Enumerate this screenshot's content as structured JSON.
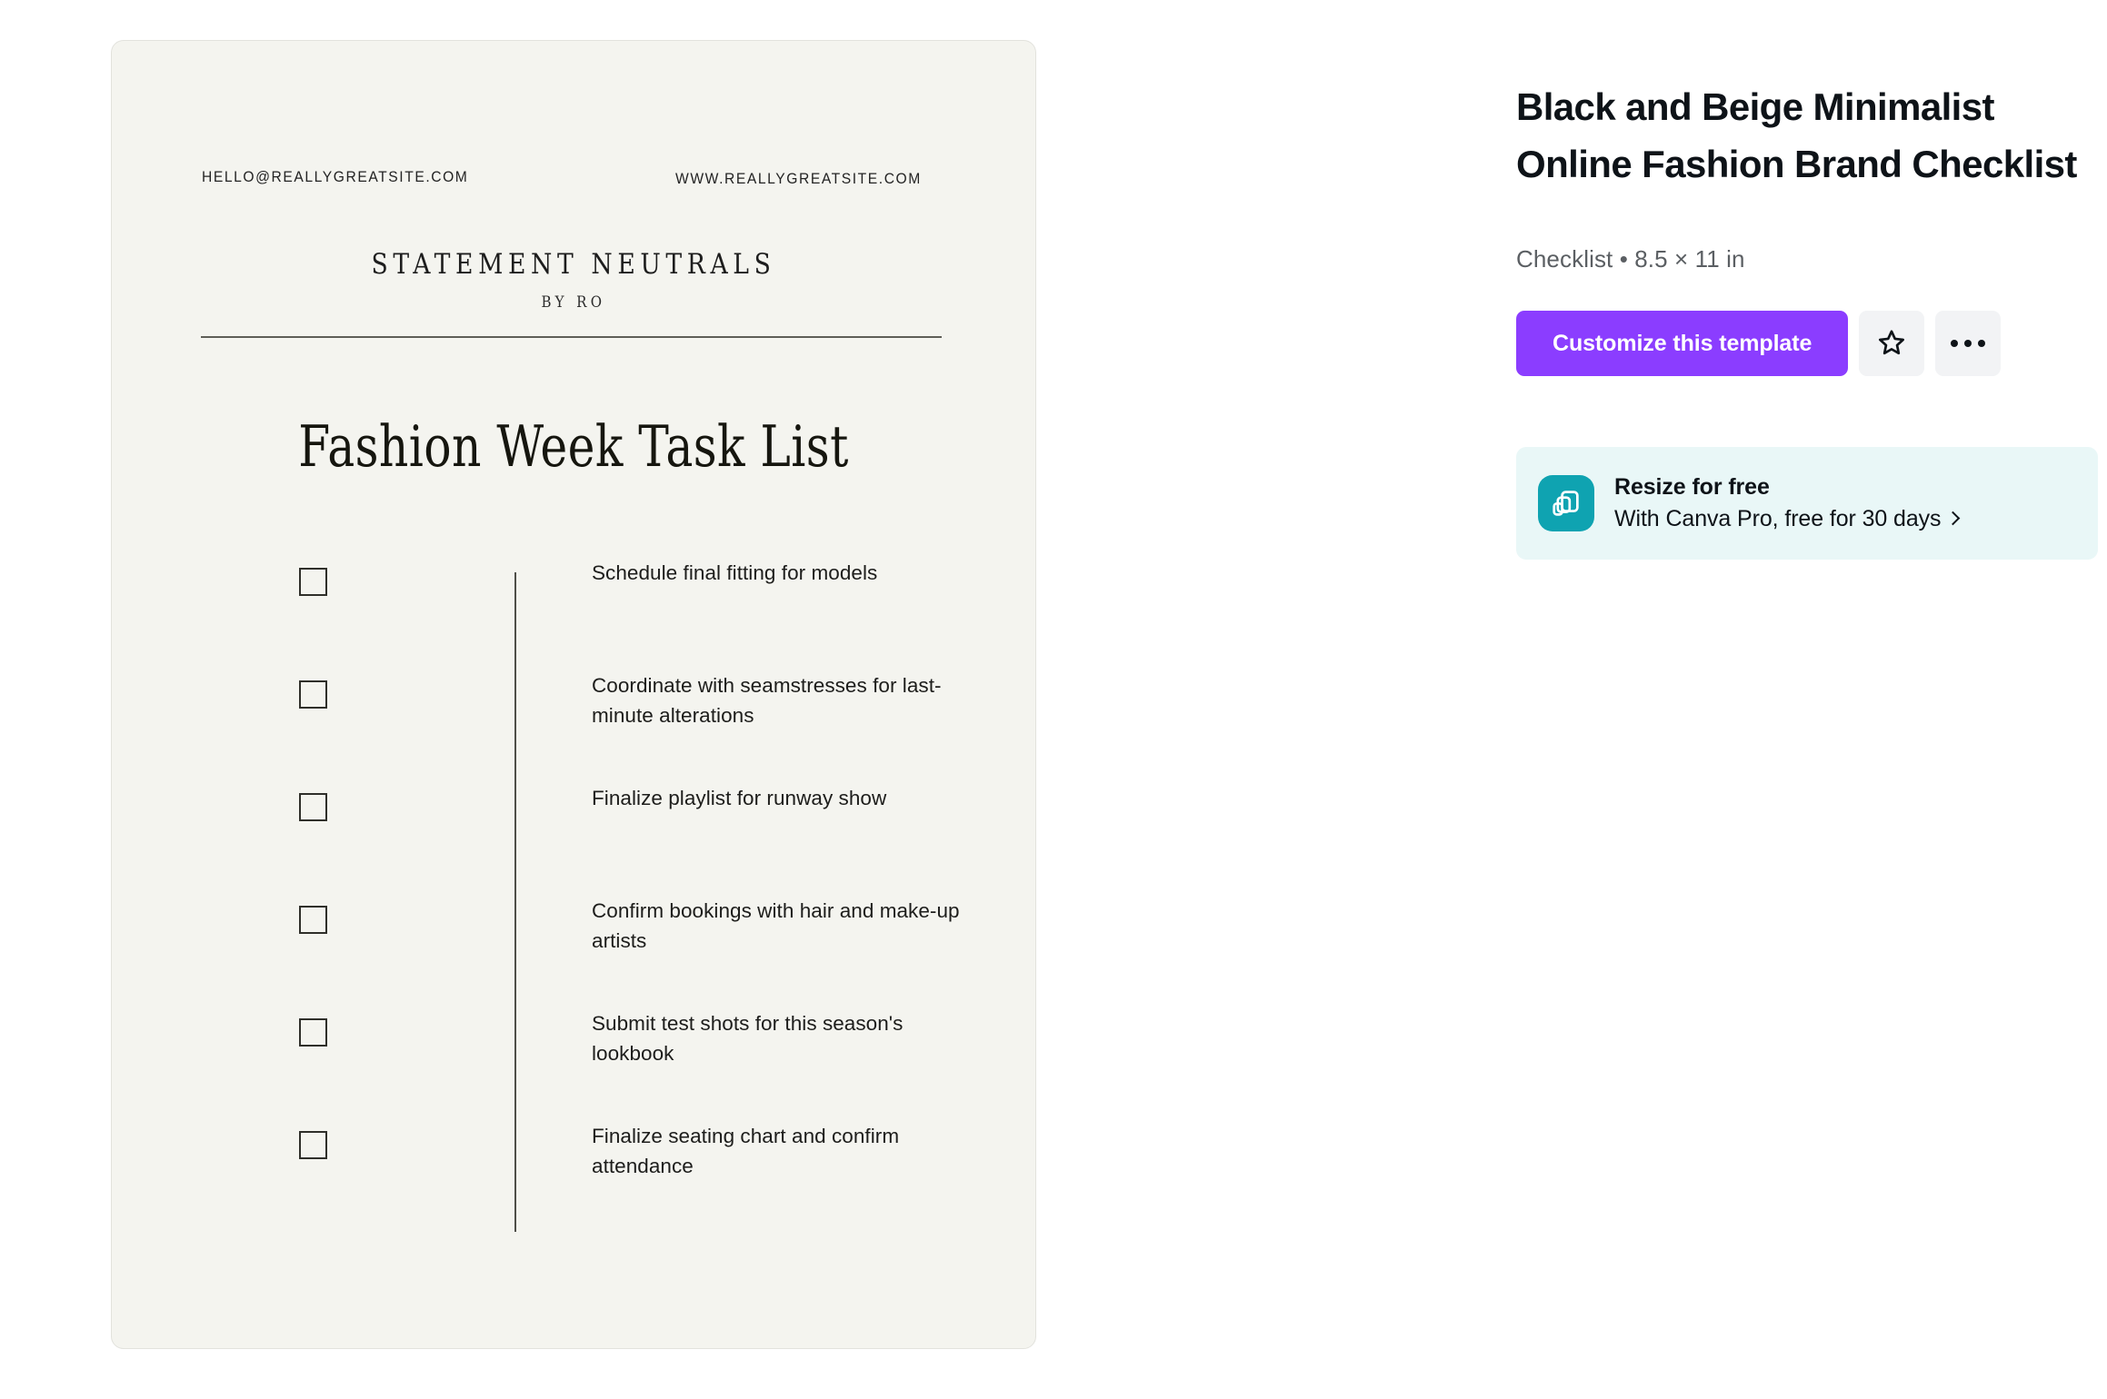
{
  "template_preview": {
    "header": {
      "email": "HELLO@REALLYGREATSITE.COM",
      "website": "WWW.REALLYGREATSITE.COM",
      "brand": "STATEMENT NEUTRALS",
      "brand_sub": "BY RO"
    },
    "title": "Fashion Week Task List",
    "checklist_items": [
      "Schedule final fitting for models",
      "Coordinate with seamstresses for last-minute alterations",
      "Finalize playlist for runway show",
      "Confirm bookings with hair and make-up artists",
      "Submit test shots for this season's lookbook",
      "Finalize seating chart and confirm attendance"
    ],
    "colors": {
      "page_background": "#f4f4ef",
      "ink": "#1d1d1b",
      "rule": "#5e5e57"
    }
  },
  "info_panel": {
    "title": "Black and Beige Minimalist Online Fashion Brand Checklist",
    "meta": "Checklist • 8.5 × 11 in",
    "customize_label": "Customize this template",
    "favorite_icon": "star-outline-icon",
    "more_icon": "more-horizontal-icon",
    "promo": {
      "title": "Resize for free",
      "subtitle": "With Canva Pro, free for 30 days",
      "icon": "resize-icon",
      "chevron": "chevron-right-icon"
    },
    "colors": {
      "accent_purple": "#8b3dff",
      "promo_background": "#e9f7f7",
      "promo_icon": "#0fa3b1",
      "icon_button_background": "#f2f3f5",
      "text_primary": "#0e1318",
      "text_secondary": "#5b5f63"
    }
  }
}
